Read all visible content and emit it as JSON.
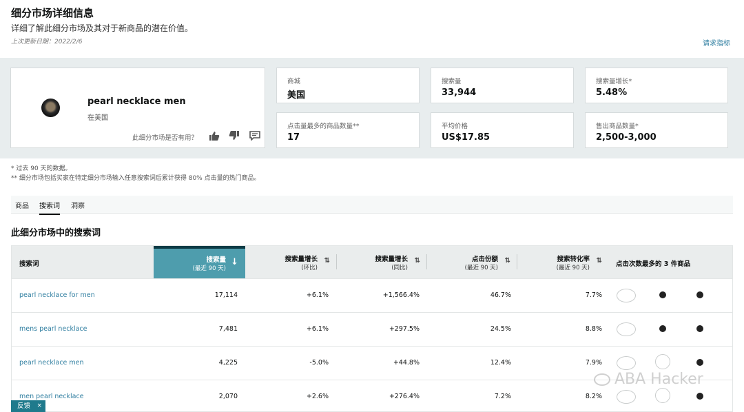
{
  "header": {
    "title": "细分市场详细信息",
    "subtitle": "详细了解此细分市场及其对于新商品的潜在价值。",
    "last_updated": "上次更新日期：2022/2/6",
    "request_metrics": "请求指标"
  },
  "product": {
    "name": "pearl necklace men",
    "locale": "在美国",
    "useful_question": "此细分市场是否有用？",
    "icons": [
      "thumbs-up-icon",
      "thumbs-down-icon",
      "comment-icon"
    ]
  },
  "metrics": [
    {
      "label": "商城",
      "value": "美国"
    },
    {
      "label": "搜索量",
      "value": "33,944"
    },
    {
      "label": "搜索量增长*",
      "value": "5.48%"
    },
    {
      "label": "点击量最多的商品数量**",
      "value": "17"
    },
    {
      "label": "平均价格",
      "value": "US$17.85"
    },
    {
      "label": "售出商品数量*",
      "value": "2,500-3,000"
    }
  ],
  "footnotes": [
    "* 过去 90 天的数据。",
    "** 细分市场包括买家在特定细分市场输入任意搜索词后累计获得 80% 点击量的热门商品。"
  ],
  "tabs": [
    {
      "label": "商品",
      "active": false
    },
    {
      "label": "搜索词",
      "active": true
    },
    {
      "label": "洞察",
      "active": false
    }
  ],
  "section_title": "此细分市场中的搜索词",
  "table": {
    "headers": [
      {
        "line1": "搜索词",
        "line2": ""
      },
      {
        "line1": "搜索量",
        "line2": "(最近 90 天)"
      },
      {
        "line1": "搜索量增长",
        "line2": "(环比)"
      },
      {
        "line1": "搜索量增长",
        "line2": "(同比)"
      },
      {
        "line1": "点击份额",
        "line2": "(最近 90 天)"
      },
      {
        "line1": "搜索转化率",
        "line2": "(最近 90 天)"
      },
      {
        "line1": "点击次数最多的 3 件商品",
        "line2": ""
      }
    ],
    "rows": [
      {
        "term": "pearl necklace for men",
        "volume": "17,114",
        "growth_qoq": "+6.1%",
        "growth_yoy": "+1,566.4%",
        "click_share": "46.7%",
        "conversion": "7.7%"
      },
      {
        "term": "mens pearl necklace",
        "volume": "7,481",
        "growth_qoq": "+6.1%",
        "growth_yoy": "+297.5%",
        "click_share": "24.5%",
        "conversion": "8.8%"
      },
      {
        "term": "pearl necklace men",
        "volume": "4,225",
        "growth_qoq": "-5.0%",
        "growth_yoy": "+44.8%",
        "click_share": "12.4%",
        "conversion": "7.9%"
      },
      {
        "term": "men pearl necklace",
        "volume": "2,070",
        "growth_qoq": "+2.6%",
        "growth_yoy": "+276.4%",
        "click_share": "7.2%",
        "conversion": "8.2%"
      }
    ]
  },
  "feedback": {
    "label": "反馈",
    "close": "×"
  },
  "watermark": "ABA Hacker",
  "colors": {
    "accent": "#4e9dad",
    "link": "#2f7ea0",
    "band": "#e8edee",
    "feedback": "#1f7a8c"
  }
}
